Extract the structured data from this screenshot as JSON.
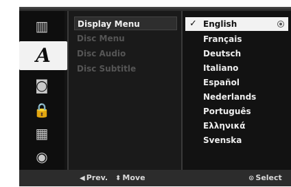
{
  "rail": {
    "items": [
      {
        "icon": "disc-menu-icon",
        "glyph": "▥"
      },
      {
        "icon": "language-a-icon",
        "glyph": "A"
      },
      {
        "icon": "speaker-icon",
        "glyph": "◙"
      },
      {
        "icon": "lock-icon",
        "glyph": "🔒"
      },
      {
        "icon": "film-icon",
        "glyph": "▦"
      },
      {
        "icon": "disc-icon",
        "glyph": "◉"
      }
    ]
  },
  "menu": {
    "items": [
      {
        "label": "Display Menu"
      },
      {
        "label": "Disc Menu"
      },
      {
        "label": "Disc Audio"
      },
      {
        "label": "Disc Subtitle"
      }
    ]
  },
  "options": {
    "items": [
      {
        "label": "English"
      },
      {
        "label": "Français"
      },
      {
        "label": "Deutsch"
      },
      {
        "label": "Italiano"
      },
      {
        "label": "Español"
      },
      {
        "label": "Nederlands"
      },
      {
        "label": "Português"
      },
      {
        "label": "Ελληνικά"
      },
      {
        "label": "Svenska"
      }
    ]
  },
  "bottom": {
    "prev_label": "Prev.",
    "move_label": "Move",
    "select_label": "Select",
    "prev_symbol": "◀",
    "move_symbol": "⬍",
    "select_symbol": "⊙"
  },
  "check_symbol": "✓"
}
